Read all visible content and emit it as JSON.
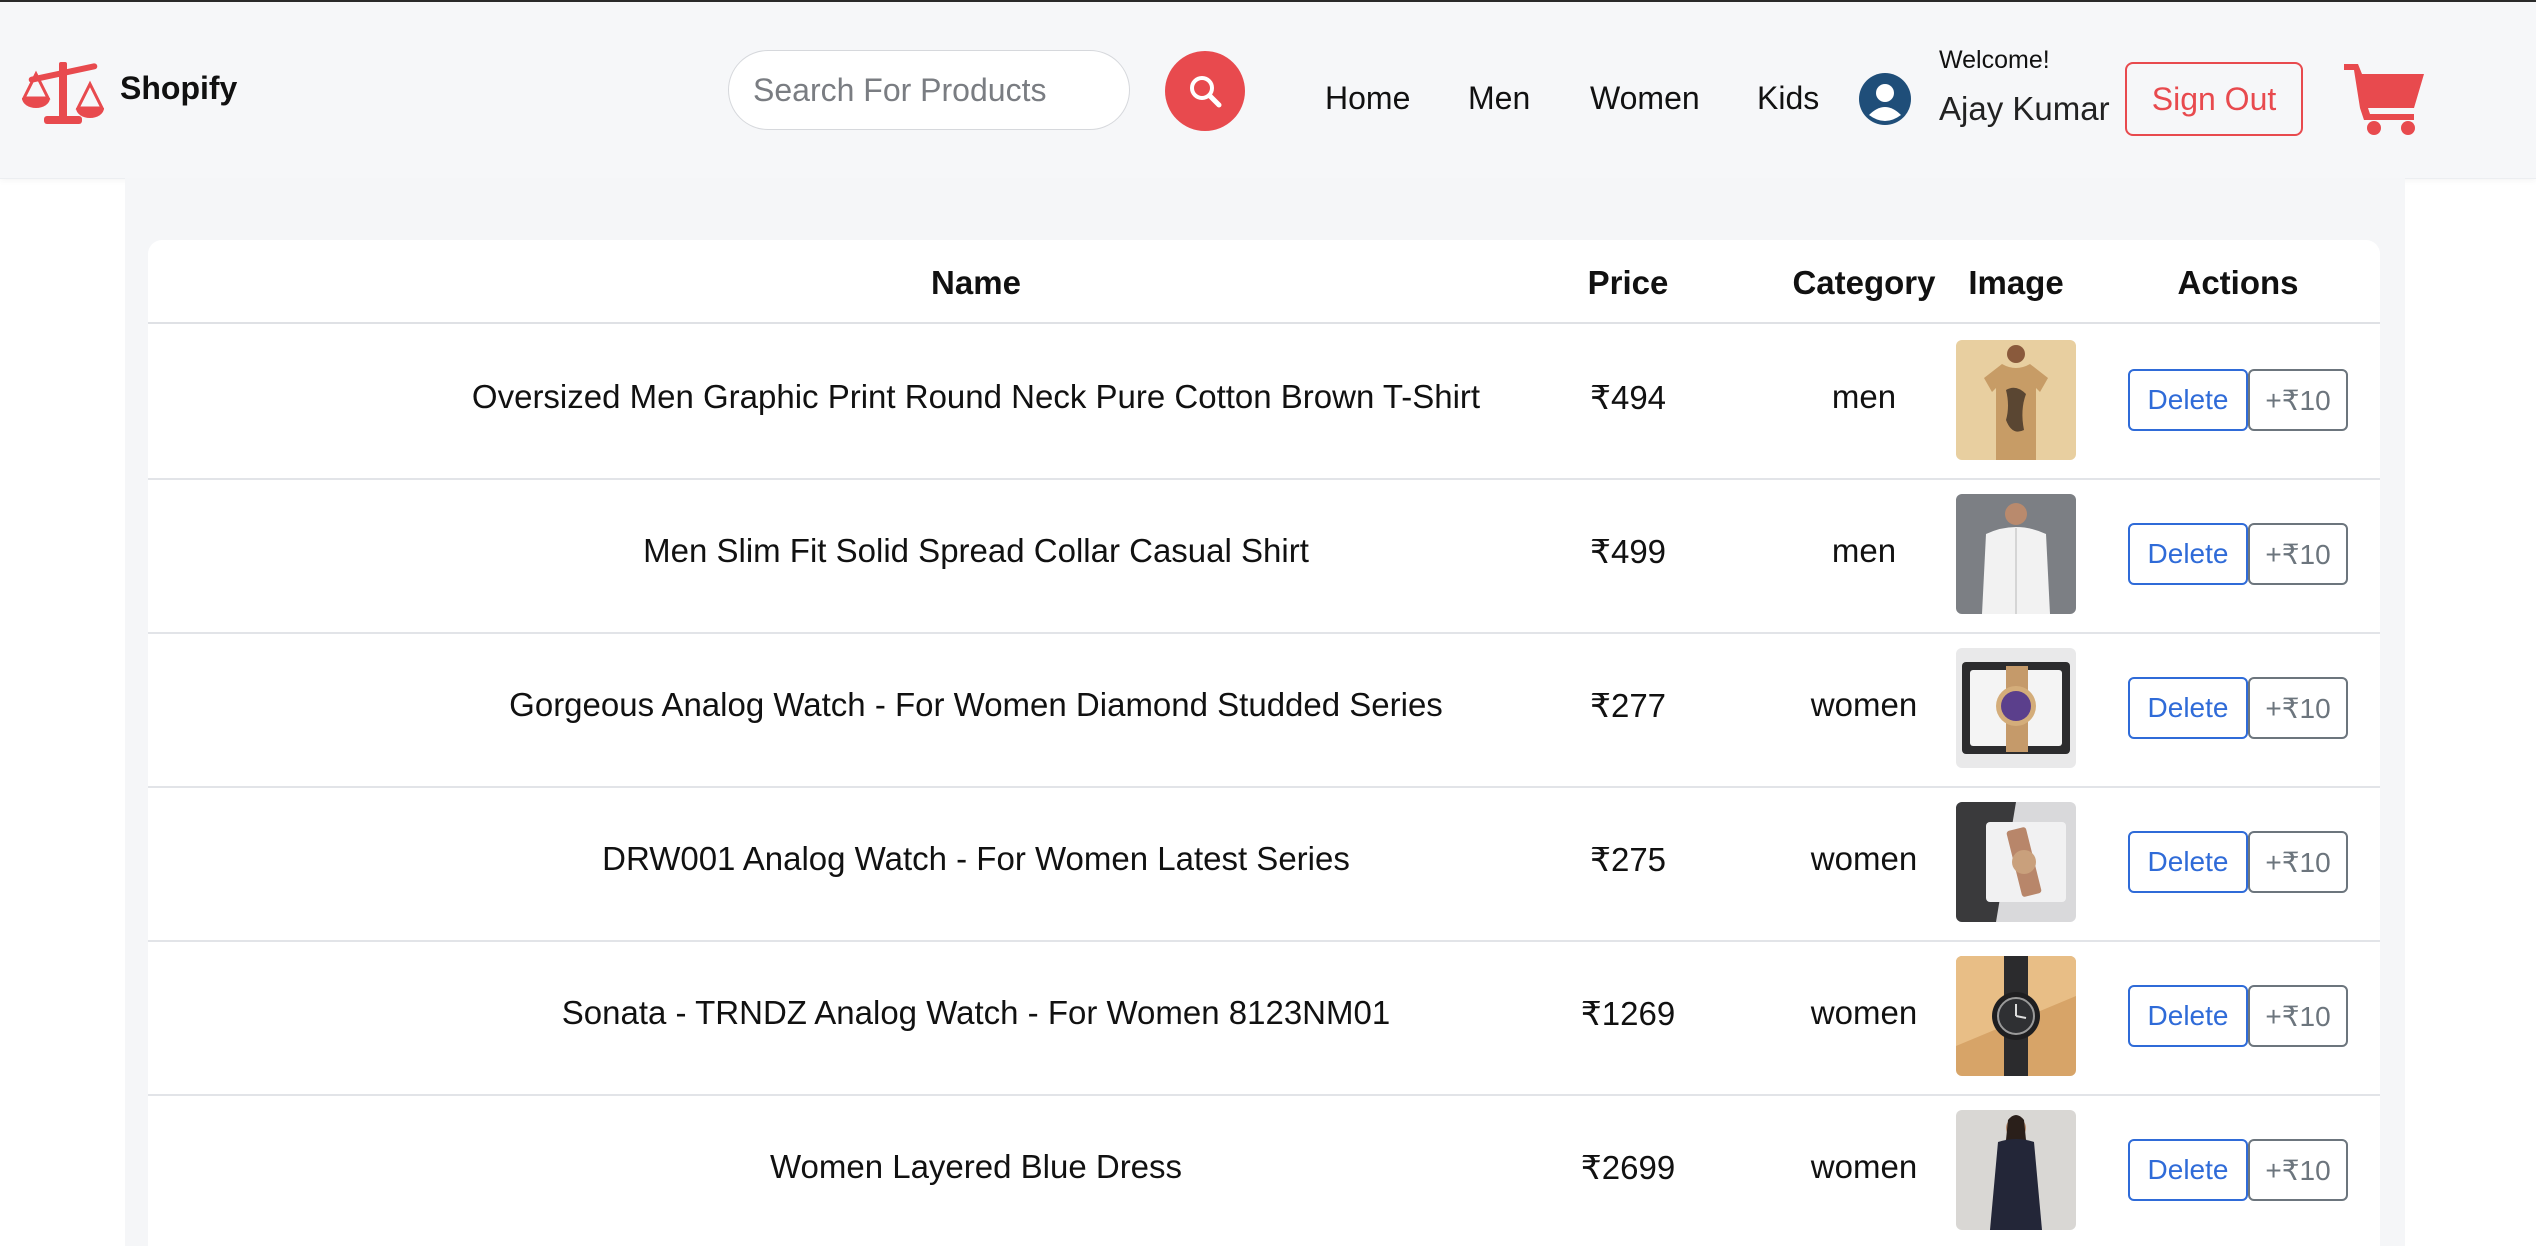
{
  "header": {
    "brand": "Shopify",
    "search_placeholder": "Search For Products",
    "nav": [
      "Home",
      "Men",
      "Women",
      "Kids"
    ],
    "welcome": "Welcome!",
    "username": "Ajay Kumar",
    "signout_label": "Sign Out"
  },
  "colors": {
    "accent": "#e84a4e",
    "primary_outline": "#2f6bd8",
    "secondary_outline": "#6c757d",
    "header_bg": "#f6f7f9",
    "avatar": "#1f4e79"
  },
  "icons": {
    "logo": "scales-icon",
    "search": "search-icon",
    "avatar": "user-circle-icon",
    "cart": "cart-icon"
  },
  "table": {
    "headers": [
      "Name",
      "Price",
      "Category",
      "Image",
      "Actions"
    ],
    "rows": [
      {
        "name": "Oversized Men Graphic Print Round Neck Pure Cotton Brown T-Shirt",
        "price": "₹494",
        "category": "men",
        "image": "tshirt-thumbnail"
      },
      {
        "name": "Men Slim Fit Solid Spread Collar Casual Shirt",
        "price": "₹499",
        "category": "men",
        "image": "shirt-thumbnail"
      },
      {
        "name": "Gorgeous Analog Watch - For Women Diamond Studded Series",
        "price": "₹277",
        "category": "women",
        "image": "watch-thumbnail"
      },
      {
        "name": "DRW001 Analog Watch - For Women Latest Series",
        "price": "₹275",
        "category": "women",
        "image": "watch-box-thumbnail"
      },
      {
        "name": "Sonata - TRNDZ Analog Watch - For Women 8123NM01",
        "price": "₹1269",
        "category": "women",
        "image": "black-watch-thumbnail"
      },
      {
        "name": "Women Layered Blue Dress",
        "price": "₹2699",
        "category": "women",
        "image": "dress-thumbnail"
      }
    ],
    "delete_label": "Delete",
    "increment_label": "+₹10"
  }
}
